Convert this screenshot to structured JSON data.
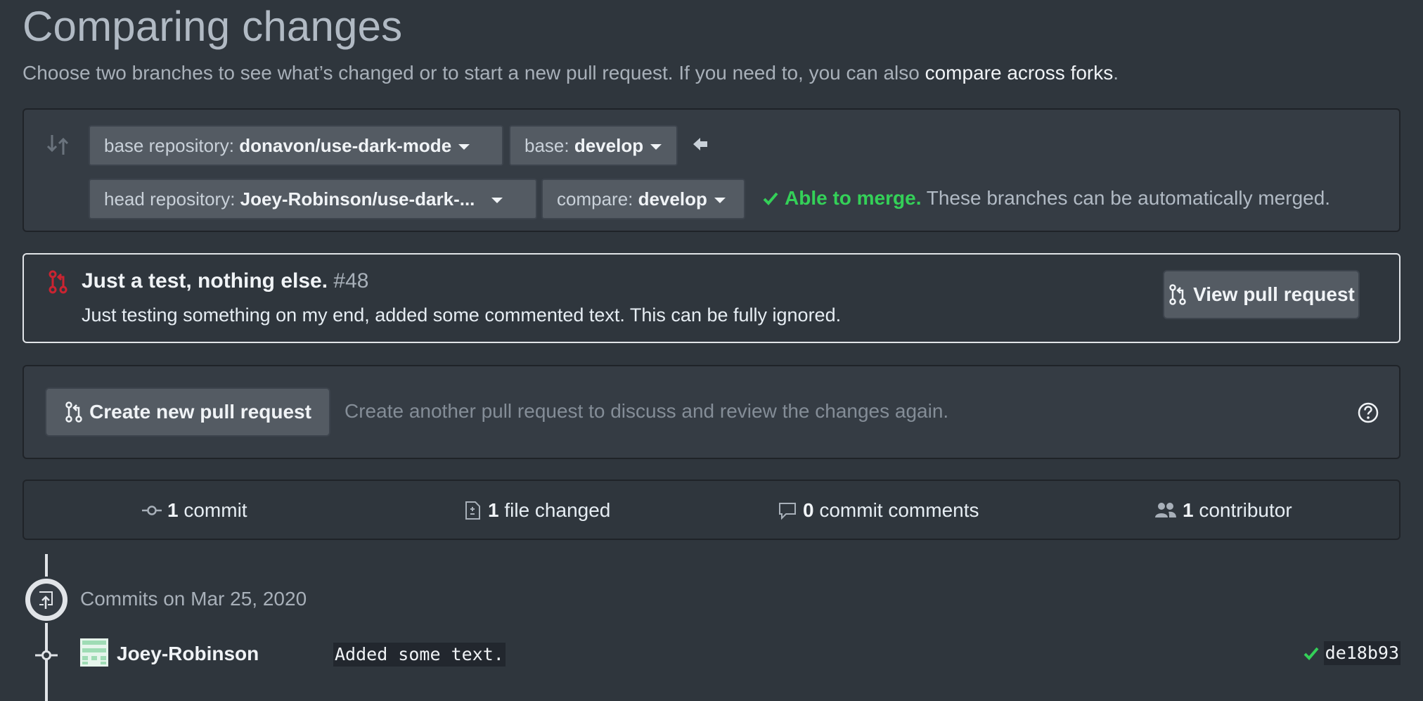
{
  "page": {
    "title": "Comparing changes",
    "subtitle_text": "Choose two branches to see what’s changed or to start a new pull request. If you need to, you can also ",
    "subtitle_link": "compare across forks",
    "subtitle_end": "."
  },
  "compare": {
    "base_repo_label": "base repository: ",
    "base_repo_value": "donavon/use-dark-mode",
    "base_label": "base: ",
    "base_value": "develop",
    "head_repo_label": "head repository: ",
    "head_repo_value": "Joey-Robinson/use-dark-...",
    "compare_label": "compare: ",
    "compare_value": "develop",
    "merge_ok": "Able to merge.",
    "merge_desc": " These branches can be automatically merged."
  },
  "pull_request": {
    "title": "Just a test, nothing else.",
    "number": "#48",
    "description": "Just testing something on my end, added some commented text. This can be fully ignored.",
    "view_button": "View pull request"
  },
  "create": {
    "button": "Create new pull request",
    "description": "Create another pull request to discuss and review the changes again."
  },
  "stats": {
    "commits_count": "1",
    "commits_label": " commit",
    "files_count": "1",
    "files_label": " file changed",
    "comments_count": "0",
    "comments_label": " commit comments",
    "contributors_count": "1",
    "contributors_label": " contributor"
  },
  "timeline": {
    "date_heading": "Commits on Mar 25, 2020",
    "commits": [
      {
        "author": "Joey-Robinson",
        "message": "Added some text.",
        "sha": "de18b93"
      }
    ]
  },
  "colors": {
    "success": "#34d058",
    "closed_pr": "#cb2431",
    "background": "#2f363d"
  }
}
